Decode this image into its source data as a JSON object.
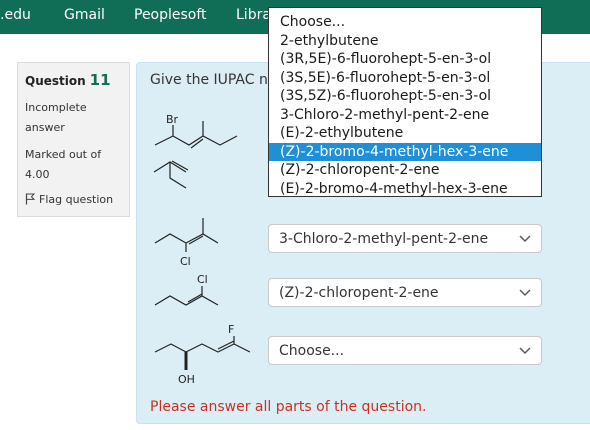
{
  "nav": {
    "items": [
      {
        "label": ".edu"
      },
      {
        "label": "Gmail"
      },
      {
        "label": "Peoplesoft"
      },
      {
        "label": "Libra"
      }
    ]
  },
  "question": {
    "label": "Question",
    "number": "11",
    "state": "Incomplete answer",
    "marked": "Marked out of 4.00",
    "flag": "Flag question",
    "text": "Give the IUPAC n"
  },
  "molecules": {
    "m1_label": "Br",
    "m3_label": "Cl",
    "m4_label": "Cl",
    "m5_label_f": "F",
    "m5_label_oh": "OH"
  },
  "selects": [
    {
      "value": "3-Chloro-2-methyl-pent-2-ene"
    },
    {
      "value": "(Z)-2-chloropent-2-ene"
    },
    {
      "value": "Choose..."
    }
  ],
  "dropdown": {
    "options": [
      "Choose...",
      "2-ethylbutene",
      "(3R,5E)-6-fluorohept-5-en-3-ol",
      "(3S,5E)-6-fluorohept-5-en-3-ol",
      "(3S,5Z)-6-fluorohept-5-en-3-ol",
      "3-Chloro-2-methyl-pent-2-ene",
      "(E)-2-ethylbutene",
      "(Z)-2-bromo-4-methyl-hex-3-ene",
      "(Z)-2-chloropent-2-ene",
      "(E)-2-bromo-4-methyl-hex-3-ene"
    ],
    "highlighted_index": 7,
    "highlight_color": "#1e90d8"
  },
  "validation": "Please answer all parts of the question.",
  "colors": {
    "nav_bg": "#0f6e55",
    "formulation_bg": "#dceef5",
    "error": "#ca3120"
  }
}
